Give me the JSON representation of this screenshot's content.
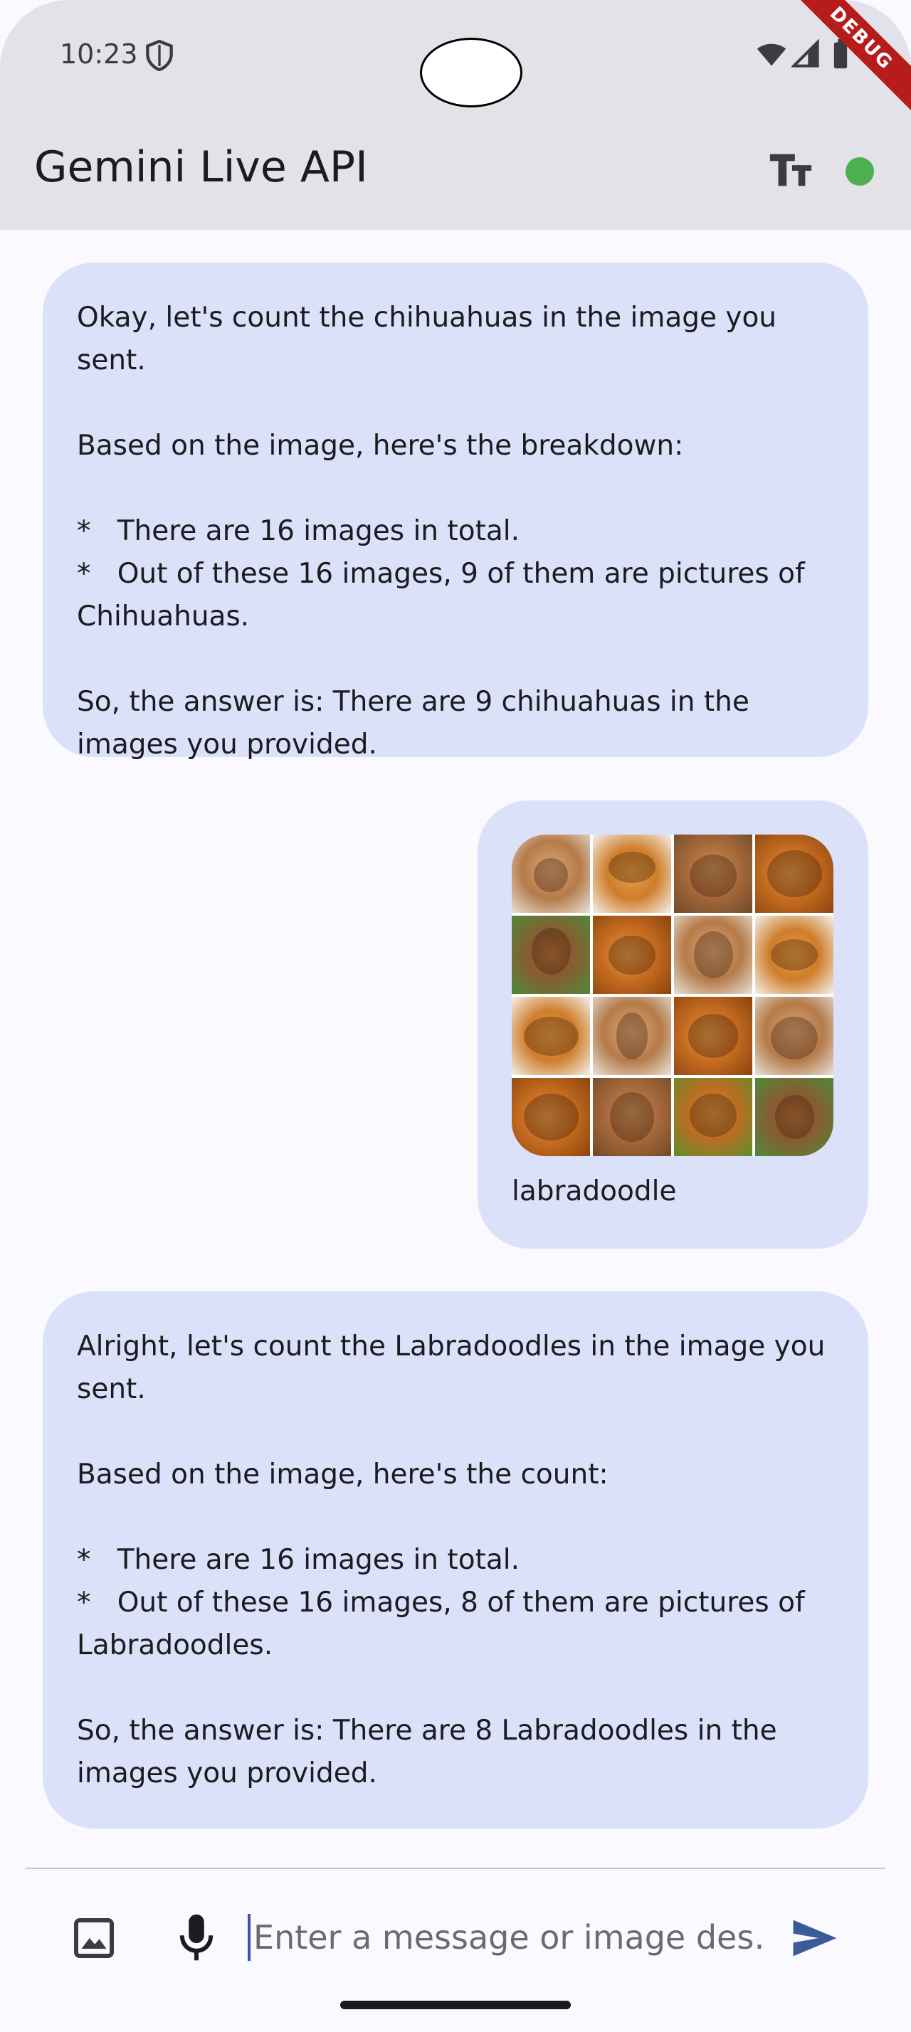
{
  "status_bar": {
    "time": "10:23",
    "debug_label": "DEBUG"
  },
  "app_bar": {
    "title": "Gemini Live API",
    "connection_color": "#4caf50"
  },
  "messages": [
    {
      "role": "model",
      "text": "Okay, let's count the chihuahuas in the image you sent.\n\nBased on the image, here's the breakdown:\n\n*   There are 16 images in total.\n*   Out of these 16 images, 9 of them are pictures of Chihuahuas.\n\nSo, the answer is: There are 9 chihuahuas in the images you provided."
    },
    {
      "role": "user",
      "caption": "labradoodle"
    },
    {
      "role": "model",
      "text": "Alright, let's count the Labradoodles in the image you sent.\n\nBased on the image, here's the count:\n\n*   There are 16 images in total.\n*   Out of these 16 images, 8 of them are pictures of Labradoodles.\n\nSo, the answer is: There are 8 Labradoodles in the images you provided."
    }
  ],
  "input_bar": {
    "placeholder": "Enter a message or image des…"
  },
  "colors": {
    "app_bar_bg": "#e2e2e8",
    "bubble_bg": "#dbe1f9",
    "send_icon": "#3d5a98"
  }
}
